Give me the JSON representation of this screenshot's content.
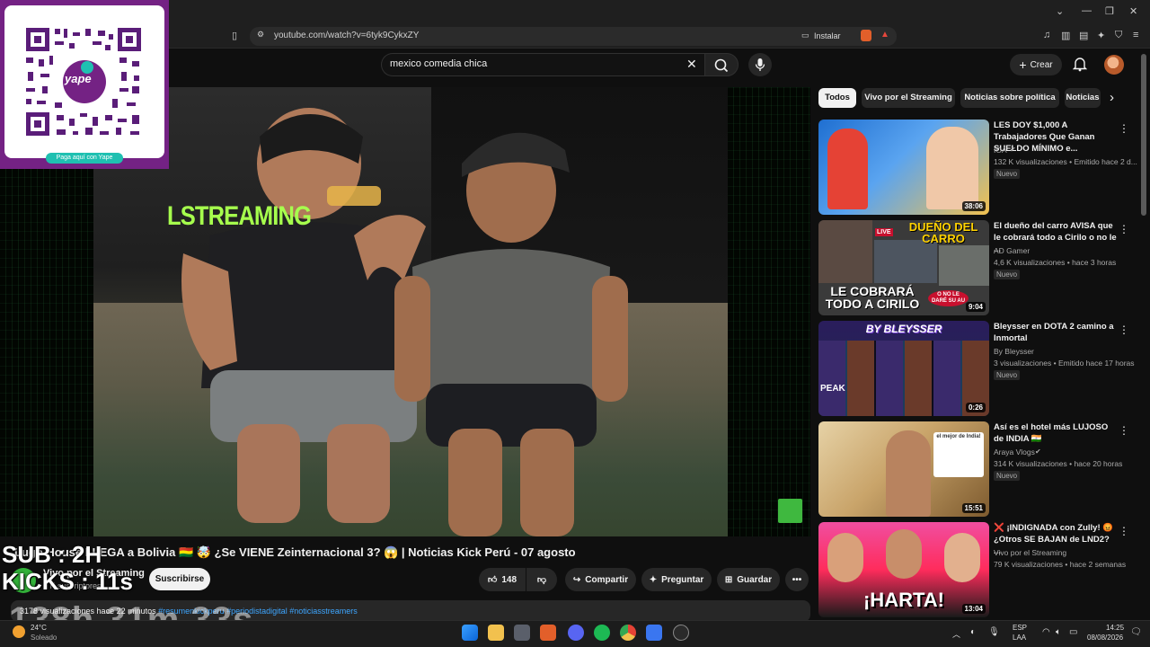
{
  "browser": {
    "url": "youtube.com/watch?v=6tyk9CykxZY",
    "install_label": "Instalar"
  },
  "header": {
    "search_query": "mexico comedia chica",
    "create_label": "Crear"
  },
  "video": {
    "overlay_text": "LSTREAMING",
    "title": "Lugo House LLEGA a Bolivia 🇧🇴 🤯 ¿Se VIENE Zeinternacional 3? 😱 | Noticias Kick Perú - 07 agosto",
    "channel_name": "Vivo por el Streaming",
    "channel_subs": "6 K suscriptores",
    "subscribe_label": "Suscribirse",
    "likes": "148",
    "share_label": "Compartir",
    "ask_label": "Preguntar",
    "save_label": "Guardar",
    "views_time": "3178 visualizaciones  hace 22 minutos",
    "hashtags": "#resumenkickperu #periodistadigital #noticiasstreamers"
  },
  "stream_overlay": {
    "sub": "SUB : 2H",
    "kicks": "KICKS : 11s",
    "timer": "138h 31m 33s"
  },
  "qr": {
    "brand": "yape",
    "cta": "Paga aquí con Yape"
  },
  "chips": [
    "Todos",
    "Vivo por el Streaming",
    "Noticias sobre política",
    "Noticias"
  ],
  "recommendations": [
    {
      "title": "LES DOY $1,000 A Trabajadores Que Ganan SUELDO MÍNIMO e...",
      "channel": "IOA",
      "meta": "132 K visualizaciones • Emitido hace 2 d...",
      "badge": "Nuevo",
      "duration": "38:06",
      "colors": [
        "#1f6fd1",
        "#e54235",
        "#f2c14e"
      ]
    },
    {
      "title": "El dueño del carro AVISA que le cobrará todo a Cirilo o no le ...",
      "channel": "AD Gamer",
      "meta": "4,6 K visualizaciones • hace 3 horas",
      "badge": "Nuevo",
      "duration": "9:04",
      "thumb_text_top": "DUEÑO DEL CARRO",
      "thumb_text_bottom": "LE COBRARÁ TODO A CIRILO",
      "thumb_text_side": "O NO LE DARÉ SU AU",
      "thumb_live": "LIVE",
      "colors": [
        "#3a3a3a",
        "#ffd200",
        "#c8102e"
      ]
    },
    {
      "title": "Bleysser en DOTA 2 camino a Inmortal",
      "channel": "By Bleysser",
      "meta": "3 visualizaciones • Emitido hace 17 horas",
      "badge": "Nuevo",
      "duration": "0:26",
      "thumb_text_top": "BY BLEYSSER",
      "thumb_text_bottom": "PEAK",
      "colors": [
        "#2a1d5c",
        "#7a46d8",
        "#1d2a4c"
      ]
    },
    {
      "title": "Así es el hotel más LUJOSO de INDIA 🇮🇳",
      "channel": "Araya Vlogs",
      "meta": "314 K visualizaciones • hace 20 horas",
      "badge": "Nuevo",
      "duration": "15:51",
      "thumb_text_top": "el mejor de India!",
      "colors": [
        "#c9a46a",
        "#7e5b2f",
        "#e6d2a6"
      ]
    },
    {
      "title": "❌ ¡INDIGNADA con Zully! 😡 ¿Otros SE BAJAN de LND2? ...",
      "channel": "Vivo por el Streaming",
      "meta": "79 K visualizaciones • hace 2 semanas",
      "badge": "",
      "duration": "13:04",
      "thumb_text_bottom": "¡HARTA!",
      "colors": [
        "#f04ea0",
        "#1a1a1a",
        "#ff2c5c"
      ]
    }
  ],
  "taskbar": {
    "weather_temp": "24°C",
    "weather_desc": "Soleado",
    "lang_top": "ESP",
    "lang_bottom": "LAA",
    "time": "14:25",
    "date": "08/08/2026"
  }
}
